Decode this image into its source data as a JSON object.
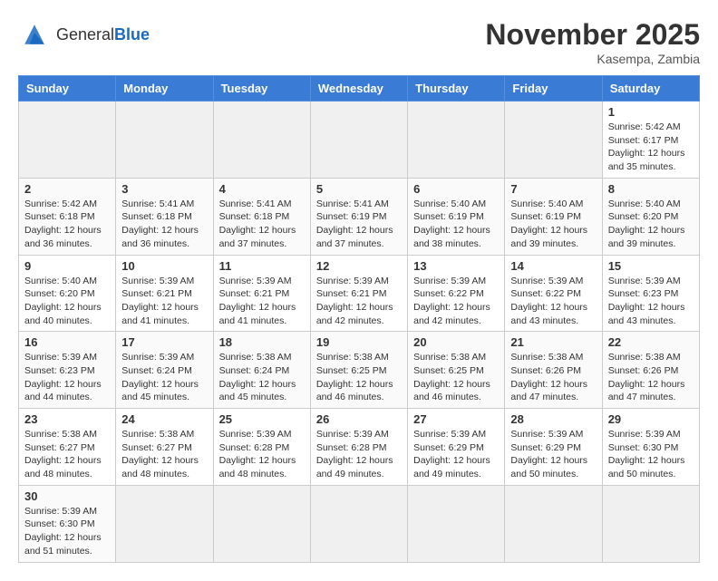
{
  "header": {
    "logo_text_general": "General",
    "logo_text_blue": "Blue",
    "month_title": "November 2025",
    "location": "Kasempa, Zambia"
  },
  "weekdays": [
    "Sunday",
    "Monday",
    "Tuesday",
    "Wednesday",
    "Thursday",
    "Friday",
    "Saturday"
  ],
  "weeks": [
    [
      {
        "day": "",
        "info": ""
      },
      {
        "day": "",
        "info": ""
      },
      {
        "day": "",
        "info": ""
      },
      {
        "day": "",
        "info": ""
      },
      {
        "day": "",
        "info": ""
      },
      {
        "day": "",
        "info": ""
      },
      {
        "day": "1",
        "info": "Sunrise: 5:42 AM\nSunset: 6:17 PM\nDaylight: 12 hours\nand 35 minutes."
      }
    ],
    [
      {
        "day": "2",
        "info": "Sunrise: 5:42 AM\nSunset: 6:18 PM\nDaylight: 12 hours\nand 36 minutes."
      },
      {
        "day": "3",
        "info": "Sunrise: 5:41 AM\nSunset: 6:18 PM\nDaylight: 12 hours\nand 36 minutes."
      },
      {
        "day": "4",
        "info": "Sunrise: 5:41 AM\nSunset: 6:18 PM\nDaylight: 12 hours\nand 37 minutes."
      },
      {
        "day": "5",
        "info": "Sunrise: 5:41 AM\nSunset: 6:19 PM\nDaylight: 12 hours\nand 37 minutes."
      },
      {
        "day": "6",
        "info": "Sunrise: 5:40 AM\nSunset: 6:19 PM\nDaylight: 12 hours\nand 38 minutes."
      },
      {
        "day": "7",
        "info": "Sunrise: 5:40 AM\nSunset: 6:19 PM\nDaylight: 12 hours\nand 39 minutes."
      },
      {
        "day": "8",
        "info": "Sunrise: 5:40 AM\nSunset: 6:20 PM\nDaylight: 12 hours\nand 39 minutes."
      }
    ],
    [
      {
        "day": "9",
        "info": "Sunrise: 5:40 AM\nSunset: 6:20 PM\nDaylight: 12 hours\nand 40 minutes."
      },
      {
        "day": "10",
        "info": "Sunrise: 5:39 AM\nSunset: 6:21 PM\nDaylight: 12 hours\nand 41 minutes."
      },
      {
        "day": "11",
        "info": "Sunrise: 5:39 AM\nSunset: 6:21 PM\nDaylight: 12 hours\nand 41 minutes."
      },
      {
        "day": "12",
        "info": "Sunrise: 5:39 AM\nSunset: 6:21 PM\nDaylight: 12 hours\nand 42 minutes."
      },
      {
        "day": "13",
        "info": "Sunrise: 5:39 AM\nSunset: 6:22 PM\nDaylight: 12 hours\nand 42 minutes."
      },
      {
        "day": "14",
        "info": "Sunrise: 5:39 AM\nSunset: 6:22 PM\nDaylight: 12 hours\nand 43 minutes."
      },
      {
        "day": "15",
        "info": "Sunrise: 5:39 AM\nSunset: 6:23 PM\nDaylight: 12 hours\nand 43 minutes."
      }
    ],
    [
      {
        "day": "16",
        "info": "Sunrise: 5:39 AM\nSunset: 6:23 PM\nDaylight: 12 hours\nand 44 minutes."
      },
      {
        "day": "17",
        "info": "Sunrise: 5:39 AM\nSunset: 6:24 PM\nDaylight: 12 hours\nand 45 minutes."
      },
      {
        "day": "18",
        "info": "Sunrise: 5:38 AM\nSunset: 6:24 PM\nDaylight: 12 hours\nand 45 minutes."
      },
      {
        "day": "19",
        "info": "Sunrise: 5:38 AM\nSunset: 6:25 PM\nDaylight: 12 hours\nand 46 minutes."
      },
      {
        "day": "20",
        "info": "Sunrise: 5:38 AM\nSunset: 6:25 PM\nDaylight: 12 hours\nand 46 minutes."
      },
      {
        "day": "21",
        "info": "Sunrise: 5:38 AM\nSunset: 6:26 PM\nDaylight: 12 hours\nand 47 minutes."
      },
      {
        "day": "22",
        "info": "Sunrise: 5:38 AM\nSunset: 6:26 PM\nDaylight: 12 hours\nand 47 minutes."
      }
    ],
    [
      {
        "day": "23",
        "info": "Sunrise: 5:38 AM\nSunset: 6:27 PM\nDaylight: 12 hours\nand 48 minutes."
      },
      {
        "day": "24",
        "info": "Sunrise: 5:38 AM\nSunset: 6:27 PM\nDaylight: 12 hours\nand 48 minutes."
      },
      {
        "day": "25",
        "info": "Sunrise: 5:39 AM\nSunset: 6:28 PM\nDaylight: 12 hours\nand 48 minutes."
      },
      {
        "day": "26",
        "info": "Sunrise: 5:39 AM\nSunset: 6:28 PM\nDaylight: 12 hours\nand 49 minutes."
      },
      {
        "day": "27",
        "info": "Sunrise: 5:39 AM\nSunset: 6:29 PM\nDaylight: 12 hours\nand 49 minutes."
      },
      {
        "day": "28",
        "info": "Sunrise: 5:39 AM\nSunset: 6:29 PM\nDaylight: 12 hours\nand 50 minutes."
      },
      {
        "day": "29",
        "info": "Sunrise: 5:39 AM\nSunset: 6:30 PM\nDaylight: 12 hours\nand 50 minutes."
      }
    ],
    [
      {
        "day": "30",
        "info": "Sunrise: 5:39 AM\nSunset: 6:30 PM\nDaylight: 12 hours\nand 51 minutes."
      },
      {
        "day": "",
        "info": ""
      },
      {
        "day": "",
        "info": ""
      },
      {
        "day": "",
        "info": ""
      },
      {
        "day": "",
        "info": ""
      },
      {
        "day": "",
        "info": ""
      },
      {
        "day": "",
        "info": ""
      }
    ]
  ]
}
